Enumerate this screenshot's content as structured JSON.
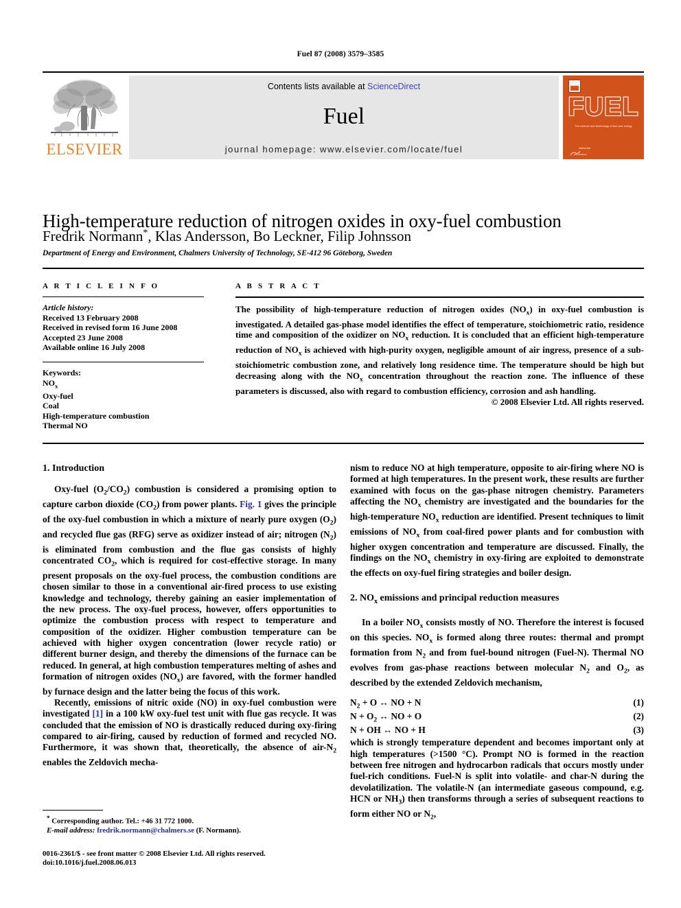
{
  "running_head": "Fuel 87 (2008) 3579–3585",
  "banner": {
    "publisher_name": "ELSEVIER",
    "contents_prefix": "Contents lists available at ",
    "contents_link": "ScienceDirect",
    "journal_name": "Fuel",
    "homepage": "journal homepage: www.elsevier.com/locate/fuel",
    "cover_title": "FUEL",
    "cover_subtitle": "The science and technology of fuel and energy",
    "cover_footer_line1": "science and",
    "cover_footer_line2": "ScienceDirect",
    "link_color": "#3b42c4",
    "brand_orange": "#E8832A",
    "cover_orange": "#D2521B",
    "band_gray": "#e6e6e6"
  },
  "article": {
    "title": "High-temperature reduction of nitrogen oxides in oxy-fuel combustion",
    "authors": "Fredrik Normann",
    "authors_rest": ", Klas Andersson, Bo Leckner, Filip Johnsson",
    "corresponding_marker": "*",
    "affiliation": "Department of Energy and Environment, Chalmers University of Technology, SE-412 96 Göteborg, Sweden"
  },
  "info": {
    "heading": "A R T I C L E   I N F O",
    "history_label": "Article history:",
    "history": [
      "Received 13 February 2008",
      "Received in revised form 16 June 2008",
      "Accepted 23 June 2008",
      "Available online 16 July 2008"
    ],
    "keywords_label": "Keywords:",
    "keywords": [
      "NOx",
      "Oxy-fuel",
      "Coal",
      "High-temperature combustion",
      "Thermal NO"
    ]
  },
  "abstract": {
    "heading": "A B S T R A C T",
    "text": "The possibility of high-temperature reduction of nitrogen oxides (NOx) in oxy-fuel combustion is investigated. A detailed gas-phase model identifies the effect of temperature, stoichiometric ratio, residence time and composition of the oxidizer on NOx reduction. It is concluded that an efficient high-temperature reduction of NOx is achieved with high-purity oxygen, negligible amount of air ingress, presence of a sub-stoichiometric combustion zone, and relatively long residence time. The temperature should be high but decreasing along with the NOx concentration throughout the reaction zone. The influence of these parameters is discussed, also with regard to combustion efficiency, corrosion and ash handling.",
    "copyright": "© 2008 Elsevier Ltd. All rights reserved."
  },
  "sections": {
    "intro_heading": "1. Introduction",
    "intro_p1_a": "Oxy-fuel (O2/CO2) combustion is considered a promising option to capture carbon dioxide (CO2) from power plants. ",
    "intro_p1_link": "Fig. 1",
    "intro_p1_b": " gives the principle of the oxy-fuel combustion in which a mixture of nearly pure oxygen (O2) and recycled flue gas (RFG) serve as oxidizer instead of air; nitrogen (N2) is eliminated from combustion and the flue gas consists of highly concentrated CO2, which is required for cost-effective storage. In many present proposals on the oxy-fuel process, the combustion conditions are chosen similar to those in a conventional air-fired process to use existing knowledge and technology, thereby gaining an easier implementation of the new process. The oxy-fuel process, however, offers opportunities to optimize the combustion process with respect to temperature and composition of the oxidizer. Higher combustion temperature can be achieved with higher oxygen concentration (lower recycle ratio) or different burner design, and thereby the dimensions of the furnace can be reduced. In general, at high combustion temperatures melting of ashes and formation of nitrogen oxides (NOx) are favored, with the former handled by furnace design and the latter being the focus of this work.",
    "intro_p2_a": "Recently, emissions of nitric oxide (NO) in oxy-fuel combustion were investigated ",
    "intro_p2_link": "[1]",
    "intro_p2_b": " in a 100 kW oxy-fuel test unit with flue gas recycle. It was concluded that the emission of NO is drastically reduced during oxy-firing compared to air-firing, caused by reduction of formed and recycled NO. Furthermore, it was shown that, theoretically, the absence of air-N2 enables the Zeldovich mechanism to reduce NO at high temperature, opposite to air-firing where NO is formed at high temperatures. In the present work, these results are further examined with focus on the gas-phase nitrogen chemistry. Parameters affecting the NOx chemistry are investigated and the boundaries for the high-temperature NOx reduction are identified. Present techniques to limit emissions of NOx from coal-fired power plants and for combustion with higher oxygen concentration and temperature are discussed. Finally, the findings on the NOx chemistry in oxy-firing are exploited to demonstrate the effects on oxy-fuel firing strategies and boiler design.",
    "nox_heading": "2. NOx emissions and principal reduction measures",
    "nox_p1": "In a boiler NOx consists mostly of NO. Therefore the interest is focused on this species. NOx is formed along three routes: thermal and prompt formation from N2 and from fuel-bound nitrogen (Fuel-N). Thermal NO evolves from gas-phase reactions between molecular N2 and O2, as described by the extended Zeldovich mechanism,",
    "equations": [
      {
        "lhs": "N2 + O ↔ NO + N",
        "number": "(1)"
      },
      {
        "lhs": "N + O2 ↔ NO + O",
        "number": "(2)"
      },
      {
        "lhs": "N + OH ↔ NO + H",
        "number": "(3)"
      }
    ],
    "nox_p2": "which is strongly temperature dependent and becomes important only at high temperatures (>1500 °C). Prompt NO is formed in the reaction between free nitrogen and hydrocarbon radicals that occurs mostly under fuel-rich conditions. Fuel-N is split into volatile- and char-N during the devolatilization. The volatile-N (an intermediate gaseous compound, e.g. HCN or NH3) then transforms through a series of subsequent reactions to form either NO or N2,"
  },
  "footnote": {
    "corresponding": "Corresponding author. Tel.: +46 31 772 1000.",
    "email_label": "E-mail address:",
    "email": "fredrik.normann@chalmers.se",
    "email_attrib": " (F. Normann)."
  },
  "imprint": {
    "line1": "0016-2361/$ - see front matter © 2008 Elsevier Ltd. All rights reserved.",
    "line2": "doi:10.1016/j.fuel.2008.06.013"
  }
}
